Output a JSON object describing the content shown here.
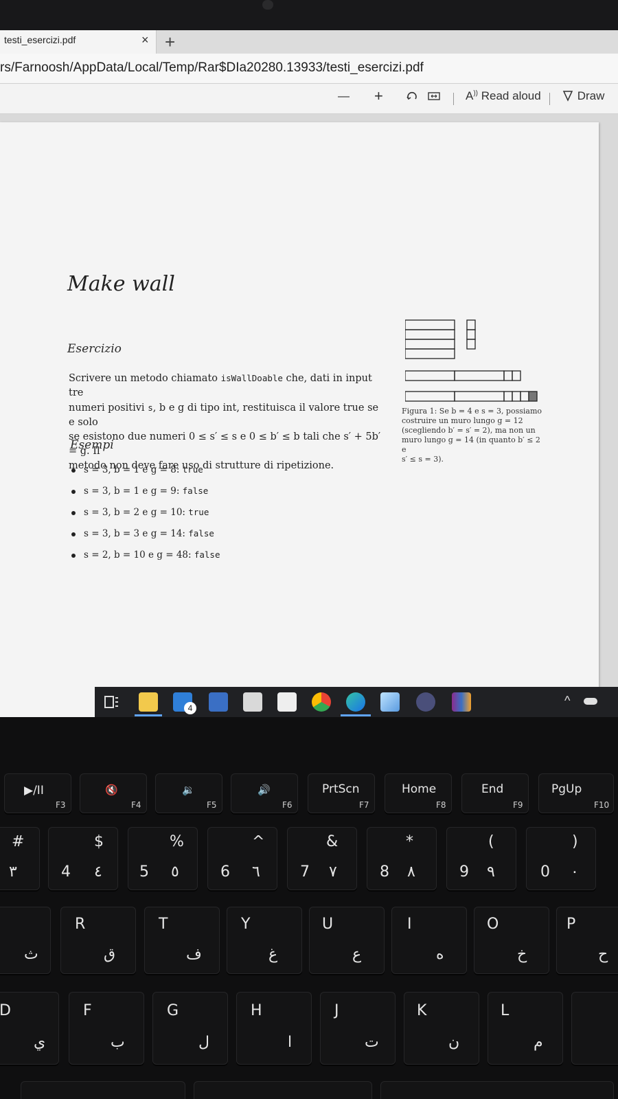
{
  "browser": {
    "tab_title": "testi_esercizi.pdf",
    "tab_close": "×",
    "new_tab": "+",
    "address": "rs/Farnoosh/AppData/Local/Temp/Rar$DIa20280.13933/testi_esercizi.pdf"
  },
  "pdf_toolbar": {
    "zoom_out": "—",
    "zoom_in": "+",
    "read_aloud": "Read aloud",
    "draw": "Draw"
  },
  "document": {
    "title": "Make wall",
    "section_exercise": "Esercizio",
    "body_lines": [
      {
        "pre": "Scrivere un metodo chiamato ",
        "code": "isWallDoable",
        "post": " che, dati in input tre"
      },
      {
        "pre": "numeri positivi ",
        "code": "s",
        "post": ", b e g di tipo int, restituisca il valore true se e solo"
      },
      {
        "pre": "se esistono due numeri 0 ≤ s′ ≤ s e 0 ≤ b′ ≤ b tali che s′ + 5b′ = g. Il",
        "code": "",
        "post": ""
      },
      {
        "pre": "metodo non deve fare uso di strutture di ripetizione.",
        "code": "",
        "post": ""
      }
    ],
    "section_examples": "Esempi",
    "examples": [
      {
        "math": "s = 3, b = 1 e g = 8: ",
        "result": "true"
      },
      {
        "math": "s = 3, b = 1 e g = 9: ",
        "result": "false"
      },
      {
        "math": "s = 3, b = 2 e g = 10: ",
        "result": "true"
      },
      {
        "math": "s = 3, b = 3 e g = 14: ",
        "result": "false"
      },
      {
        "math": "s = 2, b = 10 e g = 48: ",
        "result": "false"
      }
    ],
    "figure_caption_lines": [
      "Figura 1: Se b = 4 e s = 3, possiamo",
      "costruire un muro lungo g = 12",
      "(scegliendo b′ = s′ = 2), ma non un",
      "muro lungo g = 14 (in quanto b′ ≤ 2 e",
      "s′ ≤ s = 3)."
    ]
  },
  "taskbar": {
    "mail_badge": "4",
    "tray_arrow": "^"
  },
  "keyboard": {
    "fn_row": [
      {
        "main": "▶/II",
        "sub": "F3"
      },
      {
        "main": "🔇",
        "sub": "F4"
      },
      {
        "main": "🔉",
        "sub": "F5"
      },
      {
        "main": "🔊",
        "sub": "F6"
      },
      {
        "main": "PrtScn",
        "sub": "F7"
      },
      {
        "main": "Home",
        "sub": "F8"
      },
      {
        "main": "End",
        "sub": "F9"
      },
      {
        "main": "PgUp",
        "sub": "F10"
      }
    ],
    "number_row": [
      {
        "top": "#",
        "main": "",
        "alt": "٣"
      },
      {
        "top": "$",
        "main": "4",
        "alt": "٤"
      },
      {
        "top": "%",
        "main": "5",
        "alt": "٥"
      },
      {
        "top": "^",
        "main": "6",
        "alt": "٦"
      },
      {
        "top": "&",
        "main": "7",
        "alt": "٧"
      },
      {
        "top": "*",
        "main": "8",
        "alt": "٨"
      },
      {
        "top": "(",
        "main": "9",
        "alt": "٩"
      },
      {
        "top": ")",
        "main": "0",
        "alt": "٠"
      }
    ],
    "top_row": [
      {
        "main": "",
        "alt": "ث"
      },
      {
        "main": "R",
        "alt": "ق"
      },
      {
        "main": "T",
        "alt": "ف"
      },
      {
        "main": "Y",
        "alt": "غ"
      },
      {
        "main": "U",
        "alt": "ع"
      },
      {
        "main": "I",
        "alt": "ه"
      },
      {
        "main": "O",
        "alt": "خ"
      },
      {
        "main": "P",
        "alt": "ح"
      }
    ],
    "home_row": [
      {
        "main": "D",
        "alt": "ي"
      },
      {
        "main": "F",
        "alt": "ب"
      },
      {
        "main": "G",
        "alt": "ل"
      },
      {
        "main": "H",
        "alt": "ا"
      },
      {
        "main": "J",
        "alt": "ت"
      },
      {
        "main": "K",
        "alt": "ن"
      },
      {
        "main": "L",
        "alt": "م"
      }
    ]
  }
}
